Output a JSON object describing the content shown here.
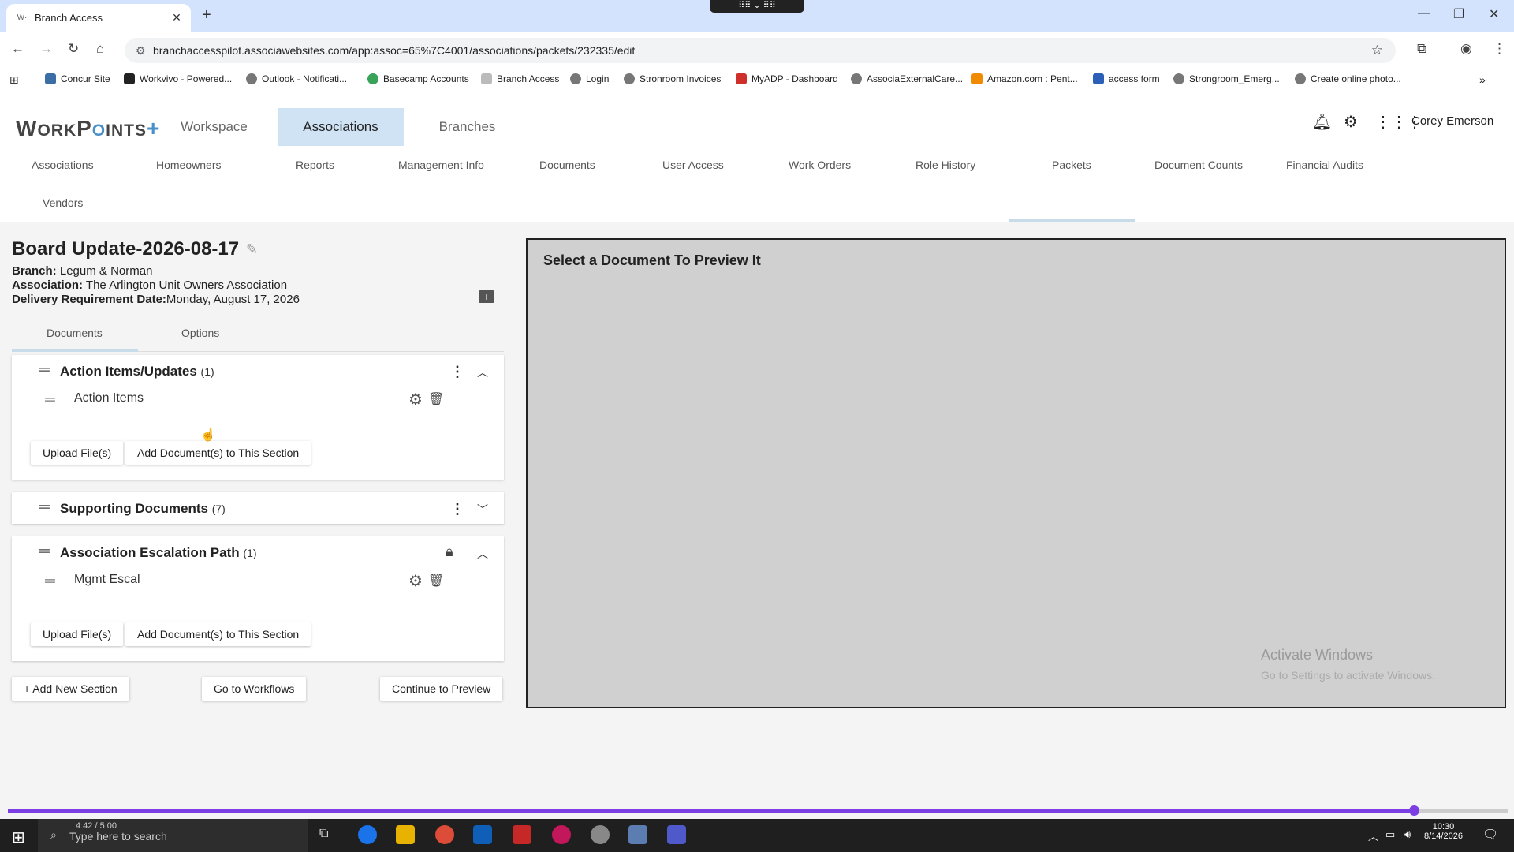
{
  "browser": {
    "tab_title": "Branch Access",
    "tab_favicon": "W·",
    "url": "branchaccesspilot.associawebsites.com/app:assoc=65%7C4001/associations/packets/232335/edit",
    "bookmarks": [
      {
        "label": "Concur Site",
        "color": "#3a6ea5"
      },
      {
        "label": "Workvivo - Powered...",
        "color": "#222222"
      },
      {
        "label": "Outlook - Notificati...",
        "color": "#555555"
      },
      {
        "label": "Basecamp Accounts",
        "color": "#3aa35a"
      },
      {
        "label": "Branch Access",
        "color": "#999999"
      },
      {
        "label": "Login",
        "color": "#555555"
      },
      {
        "label": "Stronroom Invoices",
        "color": "#555555"
      },
      {
        "label": "MyADP - Dashboard",
        "color": "#d0302b"
      },
      {
        "label": "AssociaExternalCare...",
        "color": "#555555"
      },
      {
        "label": "Amazon.com : Pent...",
        "color": "#f08a00"
      },
      {
        "label": "access form",
        "color": "#2b5fb8"
      },
      {
        "label": "Strongroom_Emerg...",
        "color": "#555555"
      },
      {
        "label": "Create online photo...",
        "color": "#555555"
      }
    ]
  },
  "app": {
    "logo": {
      "w": "W",
      "ork": "ORK",
      "p": "P",
      "o": "O",
      "ints": "INTS",
      "plus": "+"
    },
    "top_nav": [
      "Workspace",
      "Associations",
      "Branches"
    ],
    "user_name": "Corey Emerson",
    "sub_nav": [
      "Associations",
      "Homeowners",
      "Reports",
      "Management Info",
      "Documents",
      "User Access",
      "Work Orders",
      "Role History",
      "Packets",
      "Document Counts",
      "Financial Audits",
      "Vendors"
    ],
    "packet": {
      "title": "Board Update-2026-08-17",
      "branch_label": "Branch:",
      "branch": "Legum & Norman",
      "association_label": "Association:",
      "association": "The Arlington Unit Owners Association",
      "delivery_label": "Delivery Requirement Date:",
      "delivery": "Monday, August 17, 2026"
    },
    "panel_tabs": [
      "Documents",
      "Options"
    ],
    "sections": [
      {
        "title": "Action Items/Updates",
        "count": "(1)",
        "doc": "Action Items"
      },
      {
        "title": "Supporting Documents",
        "count": "(7)"
      },
      {
        "title": "Association Escalation Path",
        "count": "(1)",
        "doc": "Mgmt Escal"
      }
    ],
    "buttons": {
      "upload": "Upload File(s)",
      "add_docs": "Add Document(s) to This Section",
      "add_section": "+ Add New Section",
      "workflows": "Go to Workflows",
      "continue": "Continue to Preview"
    },
    "preview_text": "Select a Document To Preview It"
  },
  "watermark": {
    "line1": "Activate Windows",
    "line2": "Go to Settings to activate Windows."
  },
  "video": {
    "time": "4:42 / 5:00",
    "progress": 0.937
  },
  "taskbar": {
    "search_placeholder": "Type here to search",
    "clock_time": "10:30",
    "clock_date": "8/14/2026"
  }
}
